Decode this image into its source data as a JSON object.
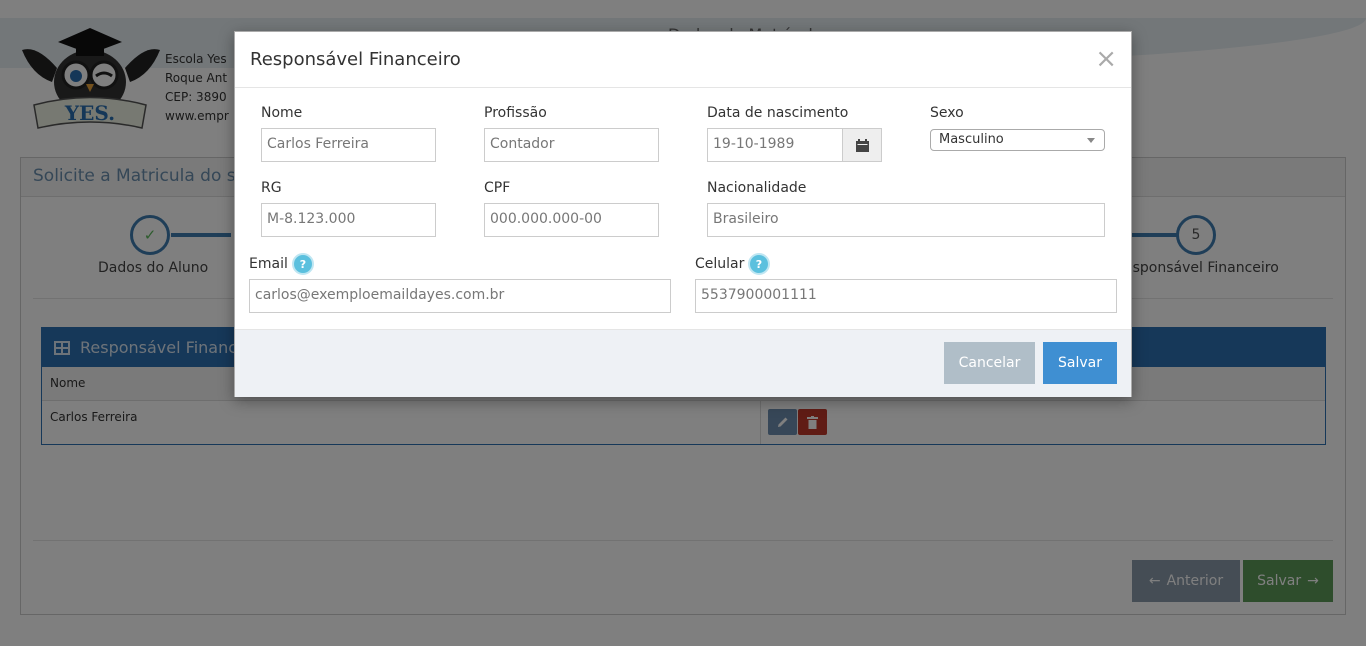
{
  "page": {
    "school_info": [
      "Escola Yes",
      "Roque Ant",
      "CEP: 3890",
      "www.empr"
    ],
    "heading": "Dados do Matrícula",
    "panel_title": "Solicite a Matricula do se"
  },
  "wizard": {
    "steps": [
      {
        "label": "Dados do Aluno",
        "marker": "✓"
      },
      {
        "label": "esponsável Financeiro",
        "marker": "5"
      }
    ]
  },
  "table": {
    "title": "Responsável Financei",
    "column_name": "Nome",
    "rows": [
      {
        "name": "Carlos Ferreira"
      }
    ]
  },
  "nav": {
    "prev": "Anterior",
    "next": "Salvar"
  },
  "modal": {
    "title": "Responsável Financeiro",
    "close": "×",
    "labels": {
      "nome": "Nome",
      "profissao": "Profissão",
      "nascimento": "Data de nascimento",
      "sexo": "Sexo",
      "rg": "RG",
      "cpf": "CPF",
      "nacionalidade": "Nacionalidade",
      "email": "Email",
      "celular": "Celular"
    },
    "values": {
      "nome": "Carlos Ferreira",
      "profissao": "Contador",
      "nascimento": "19-10-1989",
      "sexo": "Masculino",
      "rg": "M-8.123.000",
      "cpf": "000.000.000-00",
      "nacionalidade": "Brasileiro",
      "email": "carlos@exemploemaildayes.com.br",
      "celular": "5537900001111"
    },
    "help_glyph": "?",
    "cancel": "Cancelar",
    "save": "Salvar"
  }
}
